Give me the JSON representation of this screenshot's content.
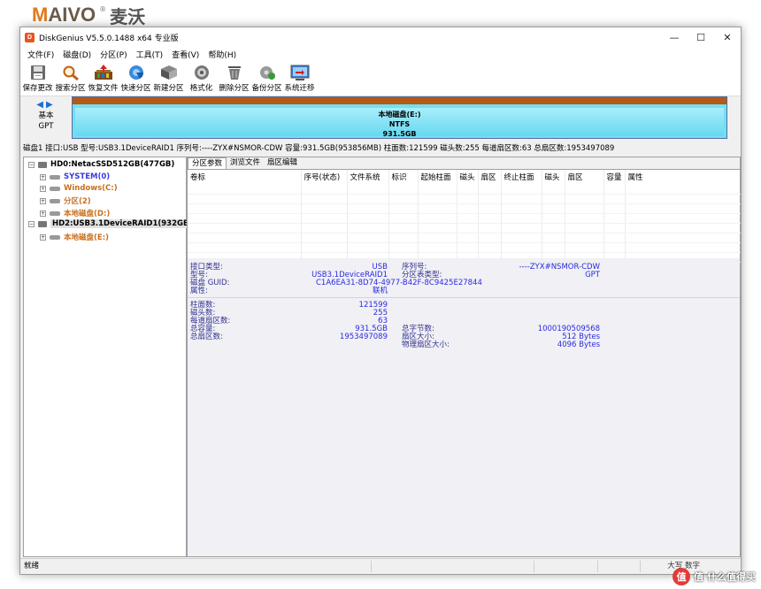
{
  "watermark_top": {
    "logo": "AIVO",
    "logo_m": "M",
    "reg": "®",
    "cn": "麦沃"
  },
  "watermark_bottom": {
    "text": "值 什么值得买",
    "badge": "值"
  },
  "window": {
    "title": "DiskGenius V5.5.0.1488 x64 专业版",
    "icon_text": "D"
  },
  "controls": {
    "minimize": "—",
    "maximize": "☐",
    "close": "✕"
  },
  "menu": [
    "文件(F)",
    "磁盘(D)",
    "分区(P)",
    "工具(T)",
    "查看(V)",
    "帮助(H)"
  ],
  "toolbar": [
    {
      "label": "保存更改",
      "icon": "save-icon"
    },
    {
      "label": "搜索分区",
      "icon": "search-partition-icon"
    },
    {
      "label": "恢复文件",
      "icon": "recover-files-icon"
    },
    {
      "label": "快速分区",
      "icon": "quick-partition-icon"
    },
    {
      "label": "新建分区",
      "icon": "new-partition-icon"
    },
    {
      "label": "格式化",
      "icon": "format-icon"
    },
    {
      "label": "删除分区",
      "icon": "delete-partition-icon"
    },
    {
      "label": "备份分区",
      "icon": "backup-partition-icon"
    },
    {
      "label": "系统迁移",
      "icon": "system-migrate-icon"
    }
  ],
  "disk_side": {
    "type": "基本",
    "scheme": "GPT"
  },
  "partition_bar": {
    "name": "本地磁盘(E:)",
    "fs": "NTFS",
    "size": "931.5GB"
  },
  "disk_info_line": "磁盘1 接口:USB  型号:USB3.1DeviceRAID1  序列号:----ZYX#NSMOR-CDW  容量:931.5GB(953856MB)  柱面数:121599  磁头数:255  每道扇区数:63  总扇区数:1953497089",
  "tree": {
    "hd0": "HD0:NetacSSD512GB(477GB)",
    "hd0_parts": [
      "SYSTEM(0)",
      "Windows(C:)",
      "分区(2)",
      "本地磁盘(D:)"
    ],
    "hd2": "HD2:USB3.1DeviceRAID1(932GB)",
    "hd2_parts": [
      "本地磁盘(E:)"
    ]
  },
  "tabs": [
    "分区参数",
    "浏览文件",
    "扇区编辑"
  ],
  "table_columns": [
    "卷标",
    "序号(状态)",
    "文件系统",
    "标识",
    "起始柱面",
    "磁头",
    "扇区",
    "终止柱面",
    "磁头",
    "扇区",
    "容量",
    "属性"
  ],
  "params": {
    "iface_label": "接口类型:",
    "iface_value": "USB",
    "serial_label": "序列号:",
    "serial_value": "----ZYX#NSMOR-CDW",
    "model_label": "型号:",
    "model_value": "USB3.1DeviceRAID1",
    "pttype_label": "分区表类型:",
    "pttype_value": "GPT",
    "guid_label": "磁盘 GUID:",
    "guid_value": "C1A6EA31-8D74-4977-B42F-8C9425E27844",
    "attr_label": "属性:",
    "attr_value": "联机",
    "cyl_label": "柱面数:",
    "cyl_value": "121599",
    "heads_label": "磁头数:",
    "heads_value": "255",
    "spt_label": "每道扇区数:",
    "spt_value": "63",
    "cap_label": "总容量:",
    "cap_value": "931.5GB",
    "bytes_label": "总字节数:",
    "bytes_value": "1000190509568",
    "sectors_label": "总扇区数:",
    "sectors_value": "1953497089",
    "secsize_label": "扇区大小:",
    "secsize_value": "512 Bytes",
    "physsec_label": "物理扇区大小:",
    "physsec_value": "4096 Bytes"
  },
  "status": {
    "left": "就绪",
    "right": "大写  数字"
  }
}
